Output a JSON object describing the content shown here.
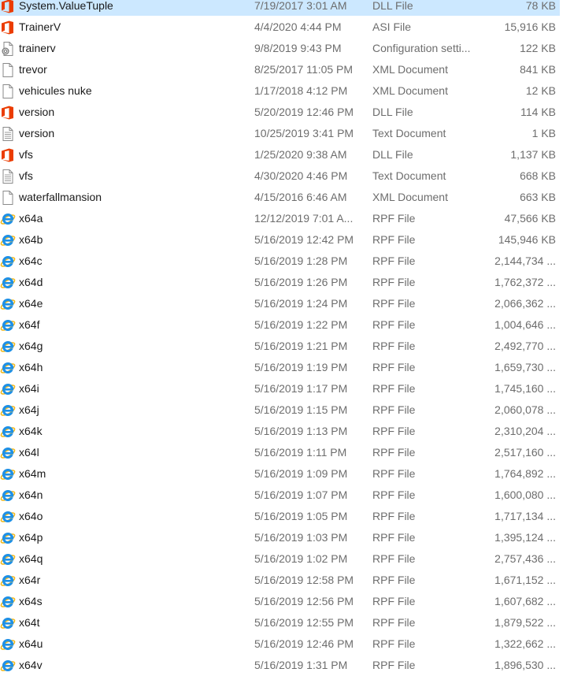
{
  "colors": {
    "selection": "#cce8ff",
    "name_text": "#1a1a1a",
    "detail_text": "#6d6d6d",
    "office_icon": "#eb3c00",
    "ie_icon": "#1e90e6"
  },
  "files": [
    {
      "icon": "office-dll-icon",
      "name": "System.ValueTuple",
      "date": "7/19/2017 3:01 AM",
      "type": "DLL File",
      "size": "78 KB",
      "selected": true
    },
    {
      "icon": "office-dll-icon",
      "name": "TrainerV",
      "date": "4/4/2020 4:44 PM",
      "type": "ASI File",
      "size": "15,916 KB"
    },
    {
      "icon": "config-file-icon",
      "name": "trainerv",
      "date": "9/8/2019 9:43 PM",
      "type": "Configuration setti...",
      "size": "122 KB"
    },
    {
      "icon": "blank-document-icon",
      "name": "trevor",
      "date": "8/25/2017 11:05 PM",
      "type": "XML Document",
      "size": "841 KB"
    },
    {
      "icon": "blank-document-icon",
      "name": "vehicules nuke",
      "date": "1/17/2018 4:12 PM",
      "type": "XML Document",
      "size": "12 KB"
    },
    {
      "icon": "office-dll-icon",
      "name": "version",
      "date": "5/20/2019 12:46 PM",
      "type": "DLL File",
      "size": "114 KB"
    },
    {
      "icon": "text-document-icon",
      "name": "version",
      "date": "10/25/2019 3:41 PM",
      "type": "Text Document",
      "size": "1 KB"
    },
    {
      "icon": "office-dll-icon",
      "name": "vfs",
      "date": "1/25/2020 9:38 AM",
      "type": "DLL File",
      "size": "1,137 KB"
    },
    {
      "icon": "text-document-icon",
      "name": "vfs",
      "date": "4/30/2020 4:46 PM",
      "type": "Text Document",
      "size": "668 KB"
    },
    {
      "icon": "blank-document-icon",
      "name": "waterfallmansion",
      "date": "4/15/2016 6:46 AM",
      "type": "XML Document",
      "size": "663 KB"
    },
    {
      "icon": "internet-explorer-icon",
      "name": "x64a",
      "date": "12/12/2019 7:01 A...",
      "type": "RPF File",
      "size": "47,566 KB"
    },
    {
      "icon": "internet-explorer-icon",
      "name": "x64b",
      "date": "5/16/2019 12:42 PM",
      "type": "RPF File",
      "size": "145,946 KB"
    },
    {
      "icon": "internet-explorer-icon",
      "name": "x64c",
      "date": "5/16/2019 1:28 PM",
      "type": "RPF File",
      "size": "2,144,734 ..."
    },
    {
      "icon": "internet-explorer-icon",
      "name": "x64d",
      "date": "5/16/2019 1:26 PM",
      "type": "RPF File",
      "size": "1,762,372 ..."
    },
    {
      "icon": "internet-explorer-icon",
      "name": "x64e",
      "date": "5/16/2019 1:24 PM",
      "type": "RPF File",
      "size": "2,066,362 ..."
    },
    {
      "icon": "internet-explorer-icon",
      "name": "x64f",
      "date": "5/16/2019 1:22 PM",
      "type": "RPF File",
      "size": "1,004,646 ..."
    },
    {
      "icon": "internet-explorer-icon",
      "name": "x64g",
      "date": "5/16/2019 1:21 PM",
      "type": "RPF File",
      "size": "2,492,770 ..."
    },
    {
      "icon": "internet-explorer-icon",
      "name": "x64h",
      "date": "5/16/2019 1:19 PM",
      "type": "RPF File",
      "size": "1,659,730 ..."
    },
    {
      "icon": "internet-explorer-icon",
      "name": "x64i",
      "date": "5/16/2019 1:17 PM",
      "type": "RPF File",
      "size": "1,745,160 ..."
    },
    {
      "icon": "internet-explorer-icon",
      "name": "x64j",
      "date": "5/16/2019 1:15 PM",
      "type": "RPF File",
      "size": "2,060,078 ..."
    },
    {
      "icon": "internet-explorer-icon",
      "name": "x64k",
      "date": "5/16/2019 1:13 PM",
      "type": "RPF File",
      "size": "2,310,204 ..."
    },
    {
      "icon": "internet-explorer-icon",
      "name": "x64l",
      "date": "5/16/2019 1:11 PM",
      "type": "RPF File",
      "size": "2,517,160 ..."
    },
    {
      "icon": "internet-explorer-icon",
      "name": "x64m",
      "date": "5/16/2019 1:09 PM",
      "type": "RPF File",
      "size": "1,764,892 ..."
    },
    {
      "icon": "internet-explorer-icon",
      "name": "x64n",
      "date": "5/16/2019 1:07 PM",
      "type": "RPF File",
      "size": "1,600,080 ..."
    },
    {
      "icon": "internet-explorer-icon",
      "name": "x64o",
      "date": "5/16/2019 1:05 PM",
      "type": "RPF File",
      "size": "1,717,134 ..."
    },
    {
      "icon": "internet-explorer-icon",
      "name": "x64p",
      "date": "5/16/2019 1:03 PM",
      "type": "RPF File",
      "size": "1,395,124 ..."
    },
    {
      "icon": "internet-explorer-icon",
      "name": "x64q",
      "date": "5/16/2019 1:02 PM",
      "type": "RPF File",
      "size": "2,757,436 ..."
    },
    {
      "icon": "internet-explorer-icon",
      "name": "x64r",
      "date": "5/16/2019 12:58 PM",
      "type": "RPF File",
      "size": "1,671,152 ..."
    },
    {
      "icon": "internet-explorer-icon",
      "name": "x64s",
      "date": "5/16/2019 12:56 PM",
      "type": "RPF File",
      "size": "1,607,682 ..."
    },
    {
      "icon": "internet-explorer-icon",
      "name": "x64t",
      "date": "5/16/2019 12:55 PM",
      "type": "RPF File",
      "size": "1,879,522 ..."
    },
    {
      "icon": "internet-explorer-icon",
      "name": "x64u",
      "date": "5/16/2019 12:46 PM",
      "type": "RPF File",
      "size": "1,322,662 ..."
    },
    {
      "icon": "internet-explorer-icon",
      "name": "x64v",
      "date": "5/16/2019 1:31 PM",
      "type": "RPF File",
      "size": "1,896,530 ..."
    }
  ]
}
